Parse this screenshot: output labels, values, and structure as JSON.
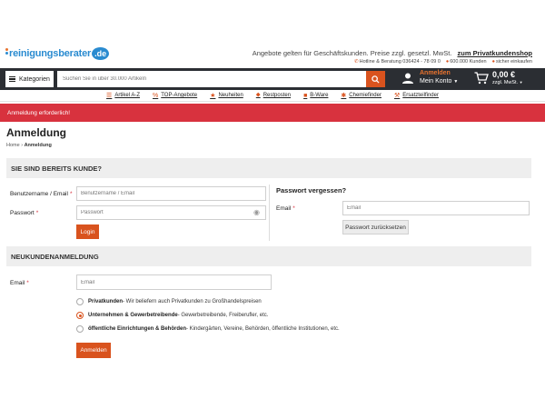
{
  "header": {
    "logo": {
      "part1": "reinigungs",
      "part2": "berater",
      "tld": ".de"
    },
    "promo_text": "Angebote gelten für Geschäftskunden. Preise zzgl. gesetzl. MwSt.",
    "promo_link": "zum Privatkundenshop",
    "meta": [
      {
        "icon": "phone-icon",
        "text": "Hotline & Beratung 036424 - 78 09 0"
      },
      {
        "icon": "users-icon",
        "text": "600.000 Kunden"
      },
      {
        "icon": "lock-icon",
        "text": "sicher einkaufen"
      }
    ]
  },
  "mainbar": {
    "categories_label": "Kategorien",
    "search_placeholder": "Suchen Sie in über 30.000 Artikeln",
    "account_line1": "Anmelden",
    "account_line2": "Mein Konto",
    "cart_amount": "0,00 €",
    "cart_tax": "zzgl. MwSt."
  },
  "catnav": [
    {
      "icon": "list-icon",
      "label": "Artikel A-Z"
    },
    {
      "icon": "percent-icon",
      "label": "TOP-Angebote"
    },
    {
      "icon": "star-icon",
      "label": "Neuheiten"
    },
    {
      "icon": "tag-icon",
      "label": "Restposten"
    },
    {
      "icon": "box-icon",
      "label": "B-Ware"
    },
    {
      "icon": "snowflake-icon",
      "label": "Chemiefinder"
    },
    {
      "icon": "tool-icon",
      "label": "Ersatzteilfinder"
    }
  ],
  "alert": "Anmeldung erforderlich!",
  "page": {
    "title": "Anmeldung",
    "breadcrumb_home": "Home",
    "breadcrumb_current": "Anmeldung"
  },
  "login": {
    "heading": "Sie sind bereits Kunde?",
    "username_label": "Benutzername / Email",
    "username_placeholder": "Benutzername / Email",
    "password_label": "Passwort",
    "password_placeholder": "Passwort",
    "login_button": "Login"
  },
  "forgot": {
    "heading": "Passwort vergessen?",
    "email_label": "Email",
    "email_placeholder": "Email",
    "reset_button": "Passwort zurücksetzen"
  },
  "register": {
    "heading": "Neukundenanmeldung",
    "email_label": "Email",
    "email_placeholder": "Email",
    "options": [
      {
        "title": "Privatkunden",
        "desc": " - Wir beliefern auch Privatkunden zu Großhandelspreisen",
        "checked": false
      },
      {
        "title": "Unternehmen & Gewerbetreibende",
        "desc": " - Gewerbetreibende, Freiberufler, etc.",
        "checked": true
      },
      {
        "title": "öffentliche Einrichtungen & Behörden",
        "desc": " - Kindergärten, Vereine, Behörden, öffentliche Institutionen, etc.",
        "checked": false
      }
    ],
    "submit_button": "Anmelden"
  },
  "colors": {
    "accent": "#d9531e",
    "alert": "#d8323e",
    "navbar": "#2b2e33",
    "brand": "#2a8bd0"
  }
}
